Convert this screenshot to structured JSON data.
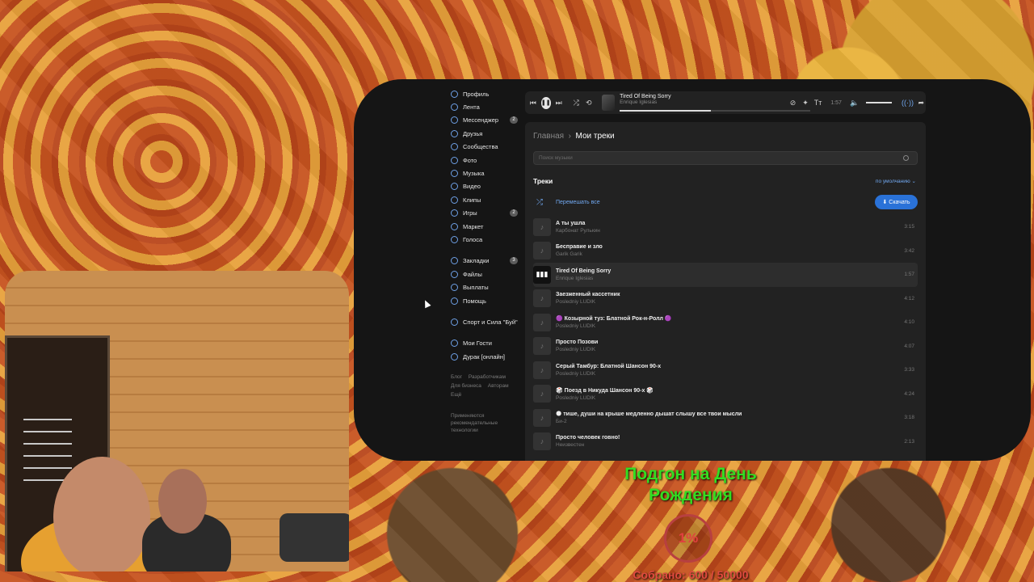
{
  "sidebar": {
    "items": [
      {
        "label": "Профиль",
        "icon": "profile-icon"
      },
      {
        "label": "Лента",
        "icon": "feed-icon"
      },
      {
        "label": "Мессенджер",
        "icon": "messenger-icon",
        "badge": "2"
      },
      {
        "label": "Друзья",
        "icon": "friends-icon"
      },
      {
        "label": "Сообщества",
        "icon": "communities-icon"
      },
      {
        "label": "Фото",
        "icon": "photo-icon"
      },
      {
        "label": "Музыка",
        "icon": "music-icon"
      },
      {
        "label": "Видео",
        "icon": "video-icon"
      },
      {
        "label": "Клипы",
        "icon": "clips-icon"
      },
      {
        "label": "Игры",
        "icon": "games-icon",
        "badge": "2"
      },
      {
        "label": "Маркет",
        "icon": "market-icon"
      },
      {
        "label": "Голоса",
        "icon": "votes-icon"
      }
    ],
    "items2": [
      {
        "label": "Закладки",
        "icon": "bookmarks-icon",
        "badge": "3"
      },
      {
        "label": "Файлы",
        "icon": "files-icon"
      },
      {
        "label": "Выплаты",
        "icon": "payments-icon"
      },
      {
        "label": "Помощь",
        "icon": "help-icon"
      }
    ],
    "group": "Спорт и Сила \"Буй\"",
    "apps": [
      "Мои Гости",
      "Дурак [онлайн]"
    ],
    "footer": [
      "Блог",
      "Разработчикам",
      "Для бизнеса",
      "Авторам",
      "Ещё"
    ],
    "recommend": "Применяются рекомендательные технологии"
  },
  "player": {
    "title": "Tired Of Being Sorry",
    "artist": "Enrique Iglesias",
    "time": "1:57",
    "progress": 0.48
  },
  "content": {
    "breadcrumb_home": "Главная",
    "breadcrumb_current": "Мои треки",
    "search_placeholder": "Поиск музыки",
    "section_title": "Треки",
    "sort_label": "по умолчанию",
    "shuffle_label": "Перемешать все",
    "download_label": "Скачать"
  },
  "tracks": [
    {
      "title": "А ты ушла",
      "artist": "Карбонат Рулькин",
      "duration": "3:15"
    },
    {
      "title": "Бесправие и зло",
      "artist": "Garik Garik",
      "duration": "3:42"
    },
    {
      "title": "Tired Of Being Sorry",
      "artist": "Enrique Iglesias",
      "duration": "1:57",
      "active": true
    },
    {
      "title": "Заезженный кассетник",
      "artist": "Posledniy LUDIK",
      "duration": "4:12"
    },
    {
      "title": "🟣 Козырной туз: Блатной Рок-н-Ролл 🟣",
      "artist": "Posledniy LUDIK",
      "duration": "4:10"
    },
    {
      "title": "Просто Позови",
      "artist": "Posledniy LUDIK",
      "duration": "4:07"
    },
    {
      "title": "Серый Тамбур: Блатной Шансон 90-х",
      "artist": "Posledniy LUDIK",
      "duration": "3:33"
    },
    {
      "title": "🎲 Поезд в Никуда Шансон 90-х 🎲",
      "artist": "Posledniy LUDIK",
      "duration": "4:24"
    },
    {
      "title": "🌑 тише, души на крыше медленно дышат слышу все твои мысли",
      "artist": "Би-2",
      "duration": "3:18"
    },
    {
      "title": "Просто человек говно!",
      "artist": "Неизвестен",
      "duration": "2:13"
    }
  ],
  "donation": {
    "title": "Подгон на День Рождения",
    "percent": "1%",
    "total": "Собрано: 600 / 50000"
  }
}
